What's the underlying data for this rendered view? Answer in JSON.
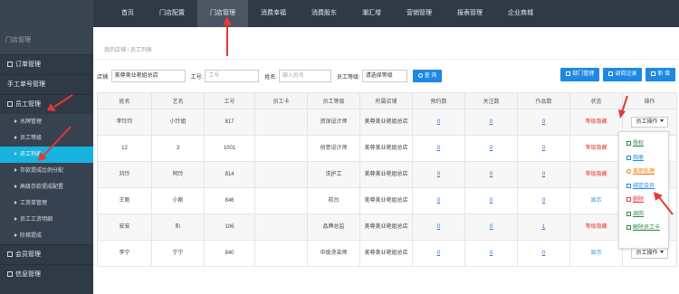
{
  "topnav": {
    "items": [
      {
        "label": "首页"
      },
      {
        "label": "门店配置"
      },
      {
        "label": "门店管理"
      },
      {
        "label": "消费幸福"
      },
      {
        "label": "消费股东"
      },
      {
        "label": "潮汇增"
      },
      {
        "label": "营销管理"
      },
      {
        "label": "报表管理"
      },
      {
        "label": "企业商城"
      }
    ],
    "active_index": 2
  },
  "sidebar": {
    "title": "门店管理",
    "order_mgmt": "订单管理",
    "manual_order": "手工单号管理",
    "staff_mgmt": "员工管理",
    "sub": {
      "brand_mgmt": "水牌管理",
      "staff_level": "员工等级",
      "staff_list": "员工列表",
      "commission_alloc": "存款提成比例分配",
      "advanced_commission": "高级存款提成配置",
      "salary_sheet": "工资单管理",
      "salary_detail": "员工工资明细",
      "tier_commission": "阶梯提成"
    },
    "member_mgmt": "会员管理",
    "info_mgmt": "信息管理"
  },
  "breadcrumb": {
    "home": "我的店铺",
    "sep": "/",
    "current": "员工列表"
  },
  "filters": {
    "store_label": "店铺:",
    "store_value": "美尊美业艳姐总店",
    "id_label": "工号:",
    "id_placeholder": "工号",
    "name_label": "姓名:",
    "name_placeholder": "输入姓名",
    "level_label": "员工等级:",
    "level_value": "请选择等级",
    "search_label": "查 询"
  },
  "toolbar": {
    "dept_mgmt": "部门管理",
    "transfer_record": "调岗记录",
    "add_new": "新 增"
  },
  "table": {
    "headers": [
      "姓名",
      "艺名",
      "工号",
      "员工卡",
      "员工等级",
      "所属店铺",
      "预约数",
      "关注数",
      "作品数",
      "状态",
      "操作"
    ],
    "rows": [
      {
        "name": "李玲玲",
        "alias": "小玲姐",
        "id": "817",
        "card": "",
        "level": "资深设计师",
        "store": "美尊美业艳姐总店",
        "appts": "0",
        "follows": "0",
        "works": "0",
        "status": "等级隐藏",
        "op": "员工操作"
      },
      {
        "name": "12",
        "alias": "3",
        "id": "1001",
        "card": "",
        "level": "创意设计师",
        "store": "美尊美业艳姐总店",
        "appts": "0",
        "follows": "0",
        "works": "0",
        "status": "等级隐藏",
        "op": ""
      },
      {
        "name": "刘玲",
        "alias": "阿玲",
        "id": "814",
        "card": "",
        "level": "洗护工",
        "store": "美尊美业艳姐总店",
        "appts": "0",
        "follows": "0",
        "works": "0",
        "status": "等级隐藏",
        "op": ""
      },
      {
        "name": "王刚",
        "alias": "小刚",
        "id": "846",
        "card": "",
        "level": "前台",
        "store": "美尊美业艳姐总店",
        "appts": "0",
        "follows": "0",
        "works": "0",
        "status": "显示",
        "op": ""
      },
      {
        "name": "安安",
        "alias": "叭",
        "id": "106",
        "card": "",
        "level": "品牌总监",
        "store": "美尊美业艳姐总店",
        "appts": "0",
        "follows": "0",
        "works": "1",
        "status": "等级隐藏",
        "op": ""
      },
      {
        "name": "李宁",
        "alias": "宁宁",
        "id": "840",
        "card": "",
        "level": "中级烫染师",
        "store": "美尊美业艳姐总店",
        "appts": "0",
        "follows": "0",
        "works": "0",
        "status": "显示",
        "op": "员工操作"
      }
    ]
  },
  "dropdown": {
    "items": [
      {
        "label": "授权",
        "color": "#2b8a3e"
      },
      {
        "label": "相册",
        "color": "#1e88e5"
      },
      {
        "label": "离职处理",
        "color": "#f57c00"
      },
      {
        "label": "绑定会员",
        "color": "#1e88e5"
      },
      {
        "label": "删除",
        "color": "#e53935"
      },
      {
        "label": "调岗",
        "color": "#2b8a3e"
      },
      {
        "label": "解除员工卡",
        "color": "#2b8a3e"
      }
    ]
  },
  "colors": {
    "annotation_red": "#e53935",
    "accent_blue": "#1e88e5",
    "sidebar_active": "#16b3df"
  }
}
